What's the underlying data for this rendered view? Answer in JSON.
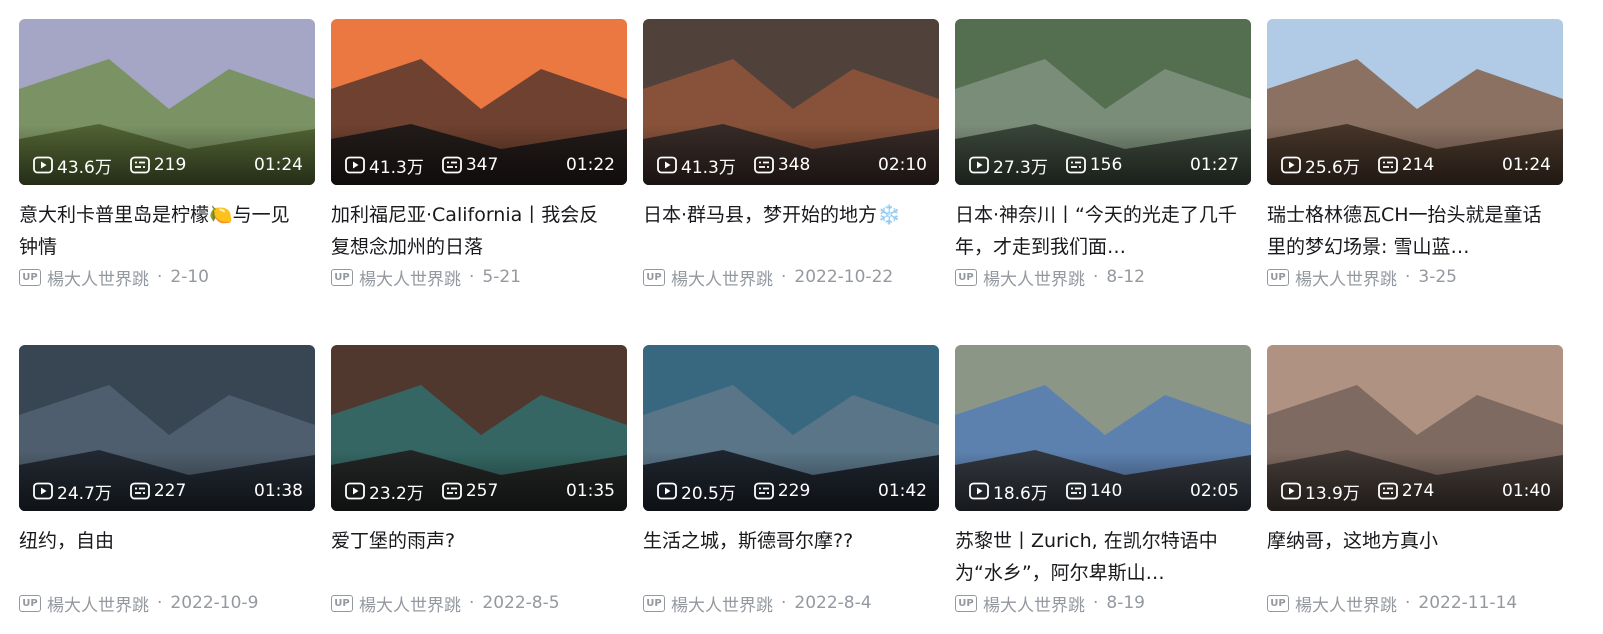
{
  "videos": [
    {
      "views": "43.6万",
      "comments": "219",
      "duration": "01:24",
      "title": "意大利卡普里岛是柠檬🍋与一见钟情",
      "up_label": "UP",
      "author": "楊大人世界跳",
      "date": "2-10",
      "thumb_colors": [
        "#7fb3d6",
        "#c59ab8",
        "#6a8a3a",
        "#4a5a2a"
      ]
    },
    {
      "views": "41.3万",
      "comments": "347",
      "duration": "01:22",
      "title": "加利福尼亚·California丨我会反复想念加州的日落",
      "up_label": "UP",
      "author": "楊大人世界跳",
      "date": "5-21",
      "thumb_colors": [
        "#f6a24a",
        "#e2563a",
        "#3a2a2a",
        "#151515"
      ]
    },
    {
      "views": "41.3万",
      "comments": "348",
      "duration": "02:10",
      "title": "日本·群马县，梦开始的地方❄️",
      "up_label": "UP",
      "author": "楊大人世界跳",
      "date": "2022-10-22",
      "thumb_colors": [
        "#6b5a4a",
        "#3a3030",
        "#a05a3a",
        "#2a2525"
      ]
    },
    {
      "views": "27.3万",
      "comments": "156",
      "duration": "01:27",
      "title": "日本·神奈川丨“今天的光走了几千年，才走到我们面…",
      "up_label": "UP",
      "author": "楊大人世界跳",
      "date": "8-12",
      "thumb_colors": [
        "#6f8a6a",
        "#3e5a3a",
        "#8a9a8a",
        "#2f3a2f"
      ]
    },
    {
      "views": "25.6万",
      "comments": "214",
      "duration": "01:24",
      "title": "瑞士格林德瓦CH一抬头就是童话里的梦幻场景: 雪山蓝…",
      "up_label": "UP",
      "author": "楊大人世界跳",
      "date": "3-25",
      "thumb_colors": [
        "#6fa0d8",
        "#e8eef4",
        "#7a4a2a",
        "#3a2a20"
      ]
    },
    {
      "views": "24.7万",
      "comments": "227",
      "duration": "01:38",
      "title": "纽约，自由",
      "up_label": "UP",
      "author": "楊大人世界跳",
      "date": "2022-10-9",
      "thumb_colors": [
        "#4a5a6a",
        "#2a3440",
        "#5a6a7a",
        "#1a2028"
      ]
    },
    {
      "views": "23.2万",
      "comments": "257",
      "duration": "01:35",
      "title": "爱丁堡的雨声?",
      "up_label": "UP",
      "author": "楊大人世界跳",
      "date": "2022-8-5",
      "thumb_colors": [
        "#6a4a3a",
        "#3a2a24",
        "#2a7a7a",
        "#1e1a18"
      ]
    },
    {
      "views": "20.5万",
      "comments": "229",
      "duration": "01:42",
      "title": "生活之城，斯德哥尔摩??",
      "up_label": "UP",
      "author": "楊大人世界跳",
      "date": "2022-8-4",
      "thumb_colors": [
        "#4aa0c0",
        "#2a3a4a",
        "#6a7a8a",
        "#14181e"
      ]
    },
    {
      "views": "18.6万",
      "comments": "140",
      "duration": "02:05",
      "title": "苏黎世丨Zurich, 在凯尔特语中为“水乡”，阿尔卑斯山…",
      "up_label": "UP",
      "author": "楊大人世界跳",
      "date": "8-19",
      "thumb_colors": [
        "#c8ccd0",
        "#5a6a4a",
        "#4a78c0",
        "#2a2a2a"
      ]
    },
    {
      "views": "13.9万",
      "comments": "274",
      "duration": "01:40",
      "title": "摩纳哥，这地方真小",
      "up_label": "UP",
      "author": "楊大人世界跳",
      "date": "2022-11-14",
      "thumb_colors": [
        "#c8b0a0",
        "#9a7a68",
        "#6a5a52",
        "#3a3230"
      ]
    }
  ]
}
